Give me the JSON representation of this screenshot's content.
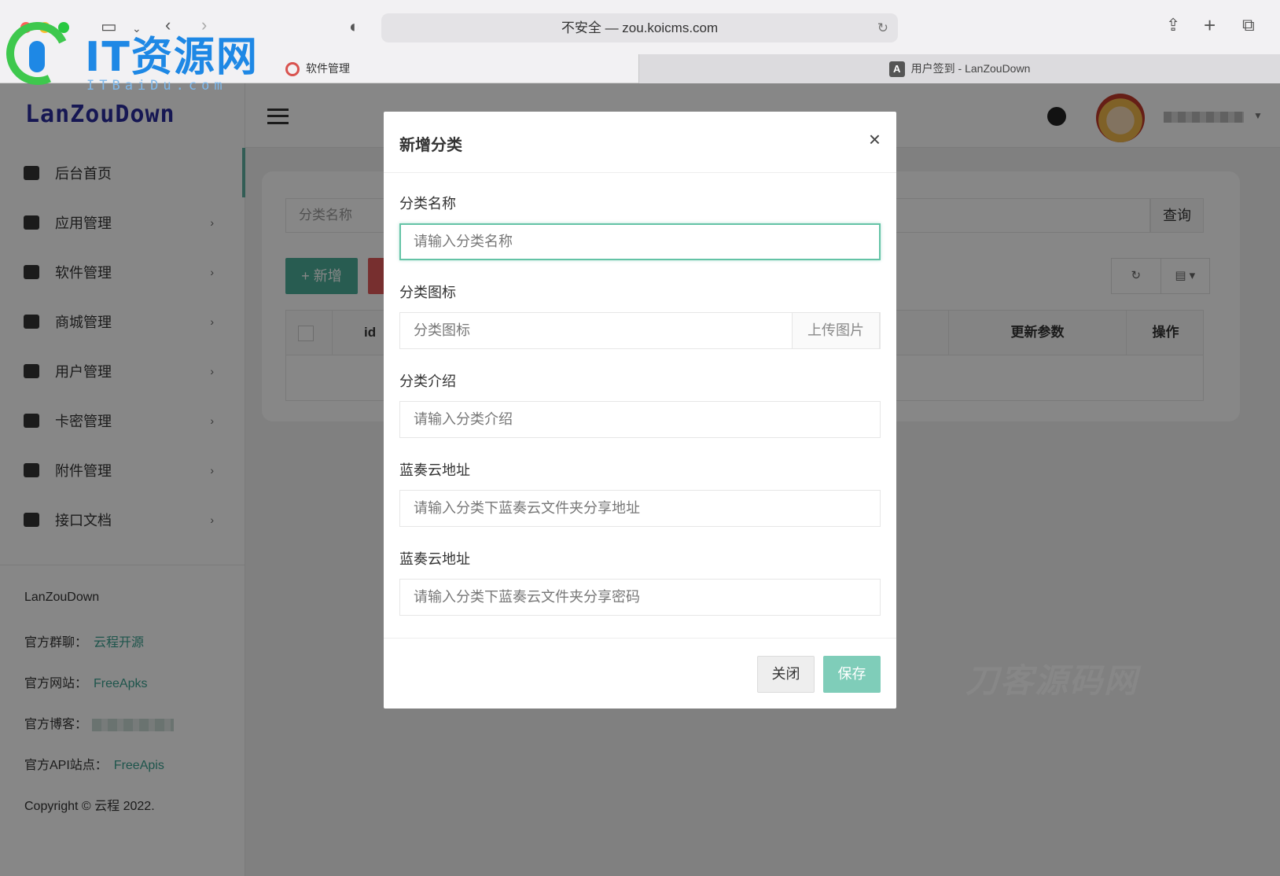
{
  "browser": {
    "address": "不安全 — zou.koicms.com",
    "tabs": [
      {
        "label": "软件管理"
      },
      {
        "label": "用户签到 - LanZouDown",
        "favicon_letter": "A"
      }
    ],
    "traffic_colors": [
      "#ff5f57",
      "#febc2e",
      "#28c840"
    ]
  },
  "watermark": {
    "title": "IT资源网",
    "subtitle": "ITBaiDu.com",
    "bg_text": "刀客源码网"
  },
  "sidebar": {
    "brand": "LanZouDown",
    "items": [
      {
        "label": "后台首页",
        "icon": "home-icon",
        "has_children": false
      },
      {
        "label": "应用管理",
        "icon": "laptop-icon",
        "has_children": true
      },
      {
        "label": "软件管理",
        "icon": "infinity-icon",
        "has_children": true
      },
      {
        "label": "商城管理",
        "icon": "store-icon",
        "has_children": true
      },
      {
        "label": "用户管理",
        "icon": "user-badge-icon",
        "has_children": true
      },
      {
        "label": "卡密管理",
        "icon": "card-icon",
        "has_children": true
      },
      {
        "label": "附件管理",
        "icon": "folder-icon",
        "has_children": true
      },
      {
        "label": "接口文档",
        "icon": "inbox-icon",
        "has_children": true
      }
    ],
    "footer": {
      "title": "LanZouDown",
      "group_label": "官方群聊：",
      "group_link": "云程开源",
      "site_label": "官方网站：",
      "site_link": "FreeApks",
      "blog_label": "官方博客：",
      "api_label": "官方API站点：",
      "api_link": "FreeApis",
      "copyright": "Copyright © 云程 2022."
    }
  },
  "main": {
    "search_placeholder": "分类名称",
    "search_button": "查询",
    "add_button": "+ 新增",
    "columns": {
      "id": "id",
      "update": "更新参数",
      "ops": "操作"
    }
  },
  "modal": {
    "title": "新增分类",
    "fields": [
      {
        "label": "分类名称",
        "placeholder": "请输入分类名称"
      },
      {
        "label": "分类图标",
        "placeholder": "分类图标",
        "upload": "上传图片"
      },
      {
        "label": "分类介绍",
        "placeholder": "请输入分类介绍"
      },
      {
        "label": "蓝奏云地址",
        "placeholder": "请输入分类下蓝奏云文件夹分享地址"
      },
      {
        "label": "蓝奏云地址",
        "placeholder": "请输入分类下蓝奏云文件夹分享密码"
      }
    ],
    "close_button": "关闭",
    "save_button": "保存"
  }
}
